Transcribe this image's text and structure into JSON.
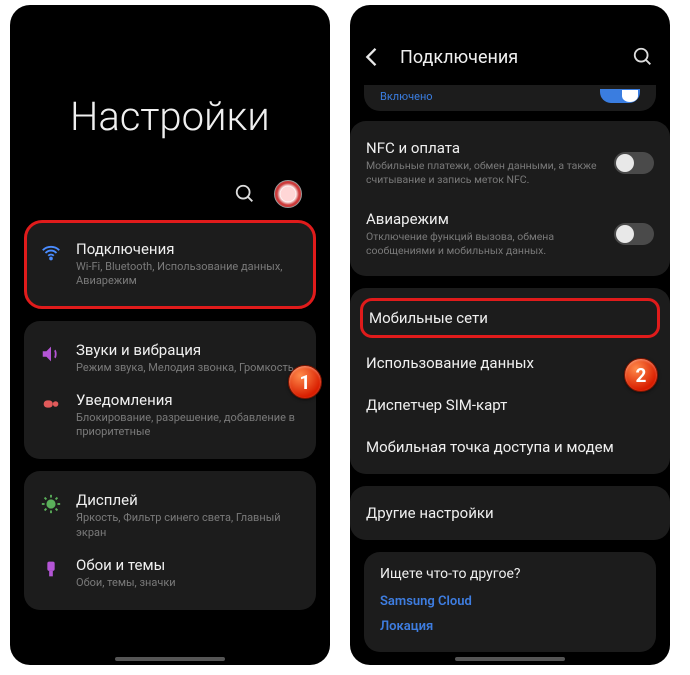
{
  "colors": {
    "accent": "#3a7de0",
    "highlight": "#e01b1b"
  },
  "badges": {
    "one": "1",
    "two": "2"
  },
  "left": {
    "title": "Настройки",
    "items": [
      {
        "icon": "wifi",
        "color": "#4a8cff",
        "title": "Подключения",
        "sub": "Wi-Fi, Bluetooth, Использование данных, Авиарежим",
        "highlight": true
      },
      {
        "icon": "sound",
        "color": "#b455d6",
        "title": "Звуки и вибрация",
        "sub": "Режим звука, Мелодия звонка, Громкость"
      },
      {
        "icon": "notif",
        "color": "#e05a5a",
        "title": "Уведомления",
        "sub": "Блокирование, разрешение, добавление в приоритетные"
      },
      {
        "icon": "display",
        "color": "#5ab05a",
        "title": "Дисплей",
        "sub": "Яркость, Фильтр синего света, Главный экран"
      },
      {
        "icon": "theme",
        "color": "#b455d6",
        "title": "Обои и темы",
        "sub": "Обои, темы, значки"
      }
    ]
  },
  "right": {
    "title": "Подключения",
    "peek_status": "Включено",
    "rows": [
      {
        "title": "NFC и оплата",
        "sub": "Мобильные платежи, обмен данными, а также считывание и запись меток NFC.",
        "toggle": false
      },
      {
        "title": "Авиарежим",
        "sub": "Отключение функций вызова, обмена сообщениями и мобильных данных.",
        "toggle": false
      },
      {
        "title": "Мобильные сети",
        "highlight": true
      },
      {
        "title": "Использование данных"
      },
      {
        "title": "Диспетчер SIM-карт"
      },
      {
        "title": "Мобильная точка доступа и модем"
      },
      {
        "title": "Другие настройки"
      }
    ],
    "other": {
      "title": "Ищете что-то другое?",
      "links": [
        "Samsung Cloud",
        "Локация"
      ]
    }
  }
}
